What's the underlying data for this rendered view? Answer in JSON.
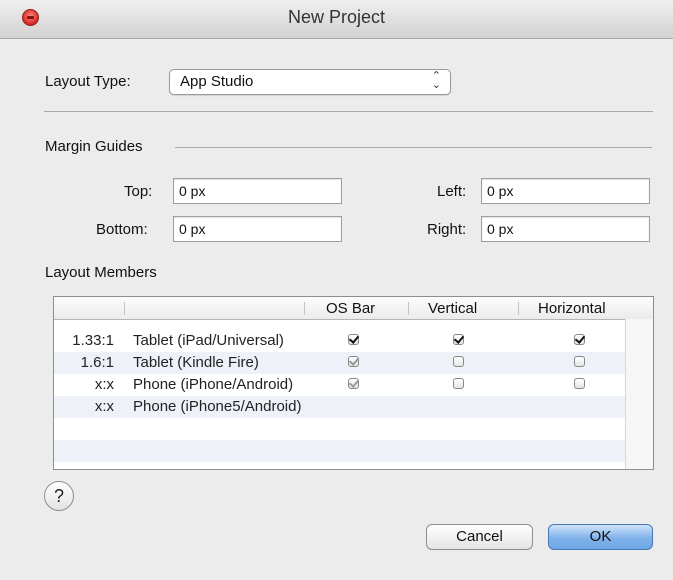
{
  "window": {
    "title": "New Project"
  },
  "layout_type": {
    "label": "Layout Type:",
    "value": "App Studio",
    "arrows": "⌃⌄"
  },
  "margin_guides": {
    "label": "Margin Guides",
    "top": {
      "label": "Top:",
      "value": "0 px"
    },
    "left": {
      "label": "Left:",
      "value": "0 px"
    },
    "bottom": {
      "label": "Bottom:",
      "value": "0 px"
    },
    "right": {
      "label": "Right:",
      "value": "0 px"
    }
  },
  "layout_members": {
    "label": "Layout Members",
    "columns": [
      "OS Bar",
      "Vertical",
      "Horizontal"
    ],
    "rows": [
      {
        "ratio": "1.33:1",
        "name": "Tablet (iPad/Universal)",
        "os_bar": "checked",
        "vertical": "checked",
        "horizontal": "checked"
      },
      {
        "ratio": "1.6:1",
        "name": "Tablet (Kindle Fire)",
        "os_bar": "checked-dim",
        "vertical": "unchecked",
        "horizontal": "unchecked"
      },
      {
        "ratio": "x:x",
        "name": "Phone (iPhone/Android)",
        "os_bar": "checked-dim",
        "vertical": "unchecked",
        "horizontal": "unchecked"
      },
      {
        "ratio": "x:x",
        "name": "Phone (iPhone5/Android)",
        "os_bar": "none",
        "vertical": "none",
        "horizontal": "none"
      }
    ]
  },
  "help_label": "?",
  "buttons": {
    "cancel": "Cancel",
    "ok": "OK"
  },
  "colors": {
    "default_button": "#7fb2ea",
    "close_button": "#d2272a",
    "alt_row": "#eef2f8"
  }
}
